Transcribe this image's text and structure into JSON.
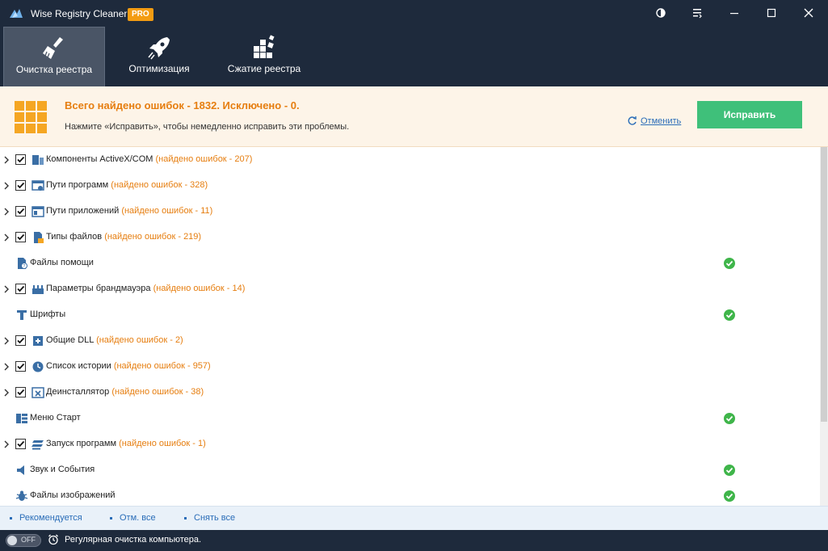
{
  "window": {
    "title": "Wise Registry Cleaner X",
    "badge": "PRO"
  },
  "tabs": [
    {
      "label": "Очистка реестра",
      "icon": "broom-icon",
      "active": true
    },
    {
      "label": "Оптимизация",
      "icon": "rocket-icon",
      "active": false
    },
    {
      "label": "Сжатие реестра",
      "icon": "blocks-icon",
      "active": false
    }
  ],
  "summary": {
    "title": "Всего найдено ошибок - 1832. Исключено - 0.",
    "hint": "Нажмите «Исправить», чтобы немедленно исправить эти проблемы.",
    "undo_label": "Отменить",
    "fix_label": "Исправить"
  },
  "categories": [
    {
      "label": "Компоненты ActiveX/COM",
      "count": "(найдено ошибок - 207)",
      "checked": true,
      "ok": false
    },
    {
      "label": "Пути программ",
      "count": "(найдено ошибок - 328)",
      "checked": true,
      "ok": false
    },
    {
      "label": "Пути приложений",
      "count": "(найдено ошибок - 11)",
      "checked": true,
      "ok": false
    },
    {
      "label": "Типы файлов",
      "count": "(найдено ошибок - 219)",
      "checked": true,
      "ok": false
    },
    {
      "label": "Файлы помощи",
      "count": "",
      "checked": false,
      "ok": true
    },
    {
      "label": "Параметры брандмауэра",
      "count": "(найдено ошибок - 14)",
      "checked": true,
      "ok": false
    },
    {
      "label": "Шрифты",
      "count": "",
      "checked": false,
      "ok": true
    },
    {
      "label": "Общие DLL",
      "count": "(найдено ошибок - 2)",
      "checked": true,
      "ok": false
    },
    {
      "label": "Список истории",
      "count": "(найдено ошибок - 957)",
      "checked": true,
      "ok": false
    },
    {
      "label": "Деинсталлятор",
      "count": "(найдено ошибок - 38)",
      "checked": true,
      "ok": false
    },
    {
      "label": "Меню Старт",
      "count": "",
      "checked": false,
      "ok": true
    },
    {
      "label": "Запуск программ",
      "count": "(найдено ошибок - 1)",
      "checked": true,
      "ok": false
    },
    {
      "label": "Звук и События",
      "count": "",
      "checked": false,
      "ok": true
    },
    {
      "label": "Файлы изображений",
      "count": "",
      "checked": false,
      "ok": true
    }
  ],
  "footer_links": {
    "recommended": "Рекомендуется",
    "select_all": "Отм. все",
    "deselect_all": "Снять все"
  },
  "status": {
    "toggle_label": "OFF",
    "toggle_on": false,
    "text": "Регулярная очистка компьютера."
  },
  "colors": {
    "header_bg": "#1e2a3c",
    "accent_orange": "#e67e10",
    "fix_green": "#3fc07a",
    "ok_green": "#3fb54a",
    "link_blue": "#2a6db8"
  }
}
